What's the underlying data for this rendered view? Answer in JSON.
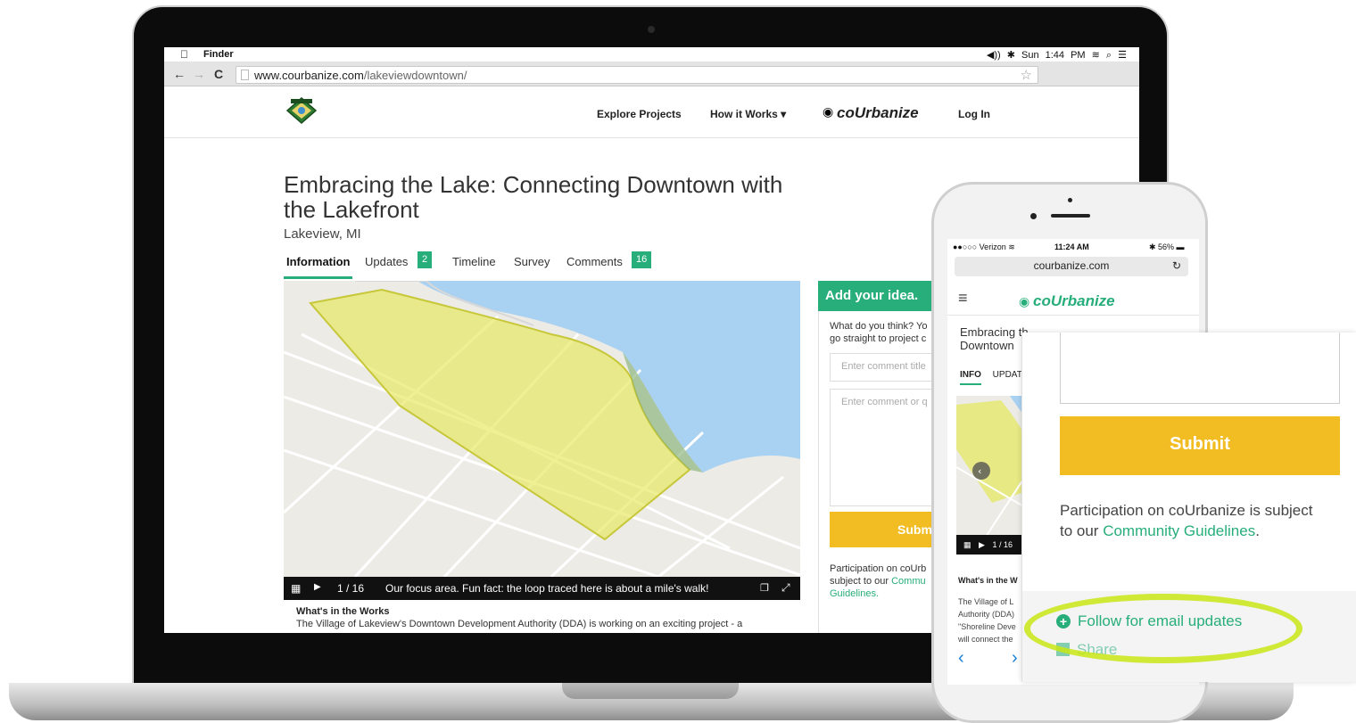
{
  "mac": {
    "app_name": "Finder",
    "status": "◀)) ✱ Sun 1:44 PM ≋ ⌕ ☰"
  },
  "browser": {
    "domain": "www.courbanize.com",
    "path": "/lakeviewdowntown/"
  },
  "site_nav": {
    "explore": "Explore Projects",
    "how": "How it Works ▾",
    "brand": "coUrbanize",
    "login": "Log In"
  },
  "project": {
    "title": "Embracing the Lake: Connecting Downtown with the Lakefront",
    "location": "Lakeview, MI"
  },
  "tabs": [
    {
      "label": "Information"
    },
    {
      "label": "Updates",
      "badge": "2"
    },
    {
      "label": "Timeline"
    },
    {
      "label": "Survey"
    },
    {
      "label": "Comments",
      "badge": "16"
    }
  ],
  "map": {
    "counter": "1 / 16",
    "caption": "Our focus area. Fun fact: the loop traced here is about a mile's walk!"
  },
  "works": {
    "title": "What's in the Works",
    "text": "The Village of Lakeview's Downtown Development Authority (DDA) is working on an exciting project - a"
  },
  "idea": {
    "header": "Add your idea.",
    "prompt_line1": "What do you think? Yo",
    "prompt_line2": "go straight to project c",
    "title_placeholder": "Enter comment title",
    "body_placeholder": "Enter comment or q",
    "submit": "Submi",
    "participation_line1": "Participation on coUrb",
    "participation_line2": "subject to our ",
    "participation_link": "Commu",
    "participation_line3": "Guidelines."
  },
  "phone": {
    "carrier": "●●○○○ Verizon ≋",
    "time": "11:24 AM",
    "battery": "✱ 56% ▬",
    "url": "courbanize.com",
    "brand": "coUrbanize",
    "title_line1": "Embracing th",
    "title_line2": "Downtown",
    "tab_info": "INFO",
    "tab_updates": "UPDAT",
    "map_counter": "1 / 16",
    "whats_title": "What's in the W",
    "whats_lines": [
      "The Village of L",
      "Authority (DDA)",
      "\"Shoreline Deve",
      "will connect the"
    ]
  },
  "zoom": {
    "submit": "Submit",
    "participation_prefix": "Participation on coUrbanize is subject to our ",
    "participation_link": "Community Guidelines",
    "participation_suffix": ".",
    "follow": "Follow for email updates",
    "share": "Share"
  },
  "colors": {
    "brand_green": "#27ae7a",
    "submit_yellow": "#f2bd23",
    "highlight": "#c8e614"
  }
}
